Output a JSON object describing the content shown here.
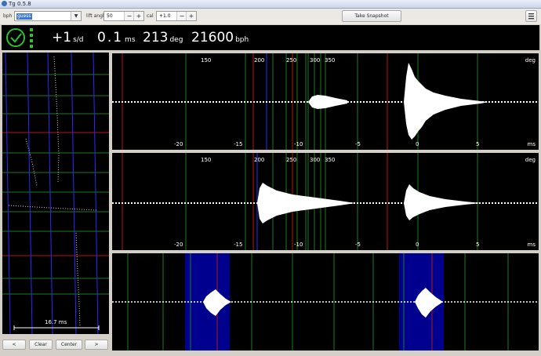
{
  "window": {
    "title": "Tg 0.5.8"
  },
  "toolbar": {
    "bph_label": "bph",
    "bph_value": "guess",
    "lift_label": "lift angle",
    "lift_value": "50",
    "cal_label": "cal",
    "cal_value": "+1.0",
    "minus": "−",
    "plus": "+",
    "snapshot_label": "Take Snapshot",
    "menu_icon": "hamburger-menu-icon"
  },
  "status": {
    "rate": "+1",
    "rate_unit": "s/d",
    "beat_error": "0.1",
    "beat_error_unit": "ms",
    "amplitude": "213",
    "amplitude_unit": "deg",
    "bph": "21600",
    "bph_unit": "bph"
  },
  "paperstrip": {
    "scale_label": "16.7 ms"
  },
  "bottom_buttons": {
    "left": "<",
    "clear": "Clear",
    "center": "Center",
    "right": ">"
  },
  "waveform": {
    "deg_unit": "deg",
    "ms_unit": "ms",
    "deg_ticks": [
      "150",
      "200",
      "250",
      "300",
      "350"
    ],
    "ms_ticks": [
      "-20",
      "-15",
      "-10",
      "-5",
      "0",
      "5"
    ]
  },
  "colors": {
    "accent": "#2ec12e",
    "bg": "#000000",
    "grid_green": "#1f7a1f",
    "grid_red": "#b31515",
    "grid_blue": "#2a2aff",
    "highlight": "#00008f"
  }
}
